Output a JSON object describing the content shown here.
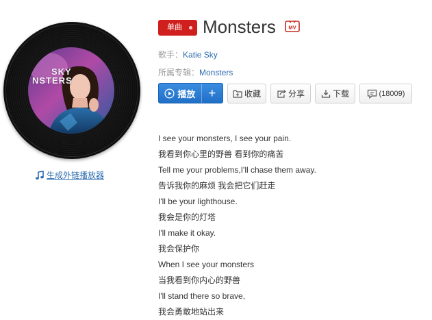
{
  "cover": {
    "line1": "SKY",
    "line2": "NSTERS"
  },
  "embed_link": "生成外链播放器",
  "header": {
    "tag": "单曲",
    "title": "Monsters",
    "mv_badge": "MV"
  },
  "meta": {
    "singer_label": "歌手：",
    "singer": "Katie Sky",
    "album_label": "所属专辑：",
    "album": "Monsters"
  },
  "actions": {
    "play": "播放",
    "add": "+",
    "collect": "收藏",
    "share": "分享",
    "download": "下载",
    "comments": "(18009)"
  },
  "lyrics": [
    "I see your monsters, I see your pain.",
    "我看到你心里的野兽 看到你的痛苦",
    "Tell me your problems,I'll chase them away.",
    "告诉我你的麻烦 我会把它们赶走",
    "I'll be your lighthouse.",
    "我会是你的灯塔",
    "I'll make it okay.",
    "我会保护你",
    "When I see your monsters",
    "当我看到你内心的野兽",
    "I'll stand there so brave,",
    "我会勇敢地站出来"
  ],
  "colors": {
    "tag_red": "#d0201e",
    "play_blue": "#2a7fd4",
    "link_blue": "#2b6cb0",
    "mv_red": "#c8281e"
  }
}
